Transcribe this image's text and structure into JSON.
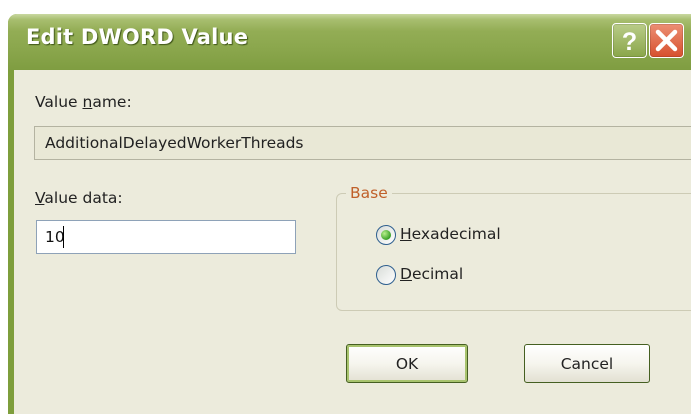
{
  "window": {
    "title": "Edit DWORD Value",
    "help_icon": "help-icon",
    "close_icon": "close-icon"
  },
  "value_name": {
    "label_prefix": "Value ",
    "label_underlined": "n",
    "label_suffix": "ame:",
    "value": "AdditionalDelayedWorkerThreads"
  },
  "value_data": {
    "label_underlined": "V",
    "label_suffix": "alue data:",
    "value": "10"
  },
  "base": {
    "title": "Base",
    "options": [
      {
        "underlined": "H",
        "rest": "exadecimal",
        "selected": true
      },
      {
        "underlined": "D",
        "rest": "ecimal",
        "selected": false
      }
    ]
  },
  "buttons": {
    "ok_label": "OK",
    "cancel_label": "Cancel"
  },
  "colors": {
    "titlebar": "#8ba74d",
    "client_background": "#ecebdc",
    "group_title": "#c0602a",
    "close_button": "#d7502e"
  }
}
